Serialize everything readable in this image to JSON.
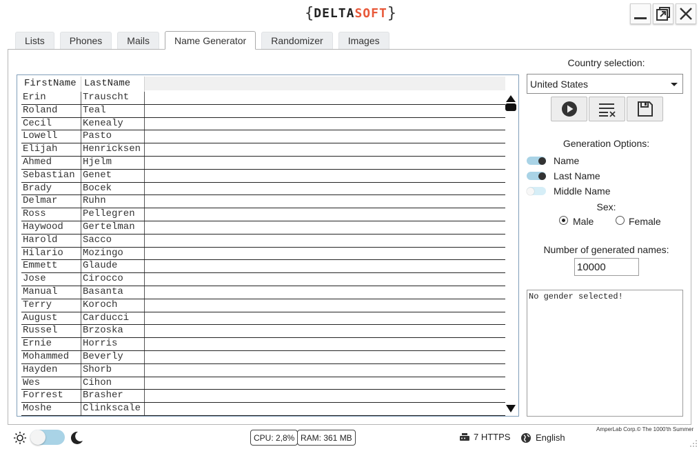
{
  "app": {
    "logo_left": "{",
    "logo_delta": "DELTA",
    "logo_soft": "SOFT",
    "logo_right": "}"
  },
  "window_controls": [
    "minimize",
    "restore",
    "close"
  ],
  "tabs": [
    {
      "label": "Lists",
      "active": false
    },
    {
      "label": "Phones",
      "active": false
    },
    {
      "label": "Mails",
      "active": false
    },
    {
      "label": "Name Generator",
      "active": true
    },
    {
      "label": "Randomizer",
      "active": false
    },
    {
      "label": "Images",
      "active": false
    }
  ],
  "grid": {
    "columns": [
      "FirstName",
      "LastName"
    ],
    "rows": [
      [
        "Erin",
        "Trauscht"
      ],
      [
        "Roland",
        "Teal"
      ],
      [
        "Cecil",
        "Kenealy"
      ],
      [
        "Lowell",
        "Pasto"
      ],
      [
        "Elijah",
        "Henricksen"
      ],
      [
        "Ahmed",
        "Hjelm"
      ],
      [
        "Sebastian",
        "Genet"
      ],
      [
        "Brady",
        "Bocek"
      ],
      [
        "Delmar",
        "Ruhn"
      ],
      [
        "Ross",
        "Pellegren"
      ],
      [
        "Haywood",
        "Gertelman"
      ],
      [
        "Harold",
        "Sacco"
      ],
      [
        "Hilario",
        "Mozingo"
      ],
      [
        "Emmett",
        "Glaude"
      ],
      [
        "Jose",
        "Cirocco"
      ],
      [
        "Manual",
        "Basanta"
      ],
      [
        "Terry",
        "Koroch"
      ],
      [
        "August",
        "Carducci"
      ],
      [
        "Russel",
        "Brzoska"
      ],
      [
        "Ernie",
        "Horris"
      ],
      [
        "Mohammed",
        "Beverly"
      ],
      [
        "Hayden",
        "Shorb"
      ],
      [
        "Wes",
        "Cihon"
      ],
      [
        "Forrest",
        "Brasher"
      ],
      [
        "Moshe",
        "Clinkscale"
      ]
    ]
  },
  "country": {
    "label": "Country selection:",
    "value": "United States"
  },
  "actions": [
    "play-icon",
    "clear-list-icon",
    "save-icon"
  ],
  "generation": {
    "label": "Generation Options:",
    "options": [
      {
        "label": "Name",
        "on": true
      },
      {
        "label": "Last Name",
        "on": true
      },
      {
        "label": "Middle Name",
        "on": false
      }
    ],
    "sex_label": "Sex:",
    "sex_options": [
      {
        "label": "Male",
        "checked": true
      },
      {
        "label": "Female",
        "checked": false
      }
    ]
  },
  "count": {
    "label": "Number of generated names:",
    "value": "10000"
  },
  "log": {
    "text": "No gender selected!"
  },
  "status": {
    "cpu": "CPU: 2,8%",
    "ram": "RAM: 361 MB",
    "https": "7 HTTPS",
    "language": "English",
    "copyright": "AmperLab Corp.© The 1000'th Summer",
    "theme_dark": false
  },
  "colors": {
    "accent_light_blue": "#a9d3e6",
    "logo_orange": "#e8593a"
  }
}
